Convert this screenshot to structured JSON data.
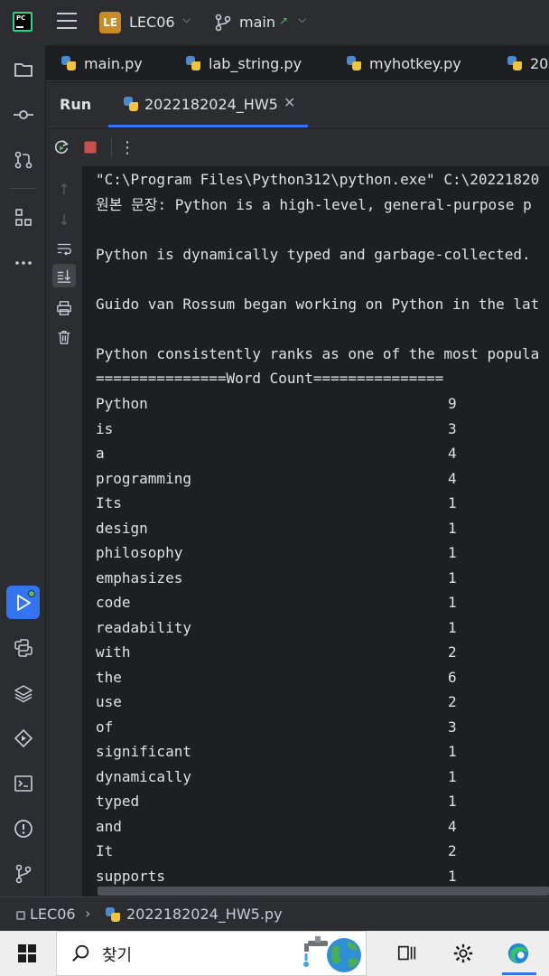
{
  "titlebar": {
    "project_badge": "LE",
    "project_name": "LEC06",
    "branch": "main",
    "branch_arrow": "↗"
  },
  "toolstrip": {
    "items": [
      "project-icon",
      "commit-icon",
      "pull-requests-icon",
      "structure-icon",
      "more-icon",
      "run-icon",
      "python-console-icon",
      "layers-icon",
      "services-icon",
      "terminal-icon",
      "problems-icon",
      "git-icon"
    ]
  },
  "editor_tabs": [
    {
      "label": "main.py"
    },
    {
      "label": "lab_string.py"
    },
    {
      "label": "myhotkey.py"
    },
    {
      "label": "20"
    }
  ],
  "run_window": {
    "title": "Run",
    "tab_label": "2022182024_HW5",
    "close_glyph": "✕",
    "more_glyph": "⋮"
  },
  "console": {
    "lines": [
      "\"C:\\Program Files\\Python312\\python.exe\" C:\\20221820",
      "원본 문장: Python is a high-level, general-purpose p",
      "",
      "Python is dynamically typed and garbage-collected.",
      "",
      "Guido van Rossum began working on Python in the lat",
      "",
      "Python consistently ranks as one of the most popula",
      "===============Word Count==============="
    ],
    "word_count": [
      {
        "word": "Python",
        "count": "9"
      },
      {
        "word": "is",
        "count": "3"
      },
      {
        "word": "a",
        "count": "4"
      },
      {
        "word": "programming",
        "count": "4"
      },
      {
        "word": "Its",
        "count": "1"
      },
      {
        "word": "design",
        "count": "1"
      },
      {
        "word": "philosophy",
        "count": "1"
      },
      {
        "word": "emphasizes",
        "count": "1"
      },
      {
        "word": "code",
        "count": "1"
      },
      {
        "word": "readability",
        "count": "1"
      },
      {
        "word": "with",
        "count": "2"
      },
      {
        "word": "the",
        "count": "6"
      },
      {
        "word": "use",
        "count": "2"
      },
      {
        "word": "of",
        "count": "3"
      },
      {
        "word": "significant",
        "count": "1"
      },
      {
        "word": "dynamically",
        "count": "1"
      },
      {
        "word": "typed",
        "count": "1"
      },
      {
        "word": "and",
        "count": "4"
      },
      {
        "word": "It",
        "count": "2"
      },
      {
        "word": "supports",
        "count": "1"
      }
    ]
  },
  "statusbar": {
    "project": "LEC06",
    "separator": "›",
    "file": "2022182024_HW5.py"
  },
  "taskbar": {
    "search_label": "찾기"
  },
  "colors": {
    "accent": "#3574f0",
    "panel": "#2b2d30",
    "editor_bg": "#1e1f22",
    "run_active_dot": "#5fb865"
  }
}
